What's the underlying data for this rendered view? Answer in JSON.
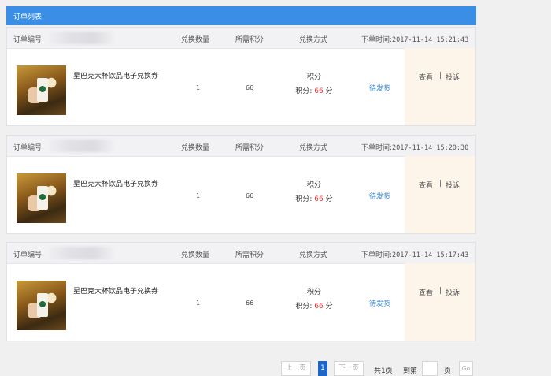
{
  "header": {
    "title": "订单列表"
  },
  "columns": {
    "order_no_label": "订单编号:",
    "qty": "兑换数量",
    "points": "所需积分",
    "method": "兑换方式",
    "time_label": "下单时间:"
  },
  "orders": [
    {
      "order_no_label": "订单编号:",
      "time": "2017-11-14 15:21:43",
      "product_name": "星巴克大杯饮品电子兑换券",
      "qty": "1",
      "points": "66",
      "method": "积分",
      "method_points_prefix": "积分:",
      "method_points_value": "66",
      "method_points_unit": "分",
      "status": "待发货",
      "view": "查看",
      "separator": "|",
      "complain": "投诉"
    },
    {
      "order_no_label": "订单编号",
      "time": "2017-11-14 15:20:30",
      "product_name": "星巴克大杯饮品电子兑换券",
      "qty": "1",
      "points": "66",
      "method": "积分",
      "method_points_prefix": "积分:",
      "method_points_value": "66",
      "method_points_unit": "分",
      "status": "待发货",
      "view": "查看",
      "separator": "|",
      "complain": "投诉"
    },
    {
      "order_no_label": "订单编号",
      "time": "2017-11-14 15:17:43",
      "product_name": "星巴克大杯饮品电子兑换券",
      "qty": "1",
      "points": "66",
      "method": "积分",
      "method_points_prefix": "积分:",
      "method_points_value": "66",
      "method_points_unit": "分",
      "status": "待发货",
      "view": "查看",
      "separator": "|",
      "complain": "投诉"
    }
  ],
  "pager": {
    "prev": "上一页",
    "current": "1",
    "next": "下一页",
    "total": "共1页",
    "goto_label": "到第",
    "page_unit": "页",
    "go": "Go"
  },
  "colors": {
    "accent": "#3b8ee6",
    "points_red": "#e0312f",
    "ops_bg": "#fdf4ea"
  }
}
